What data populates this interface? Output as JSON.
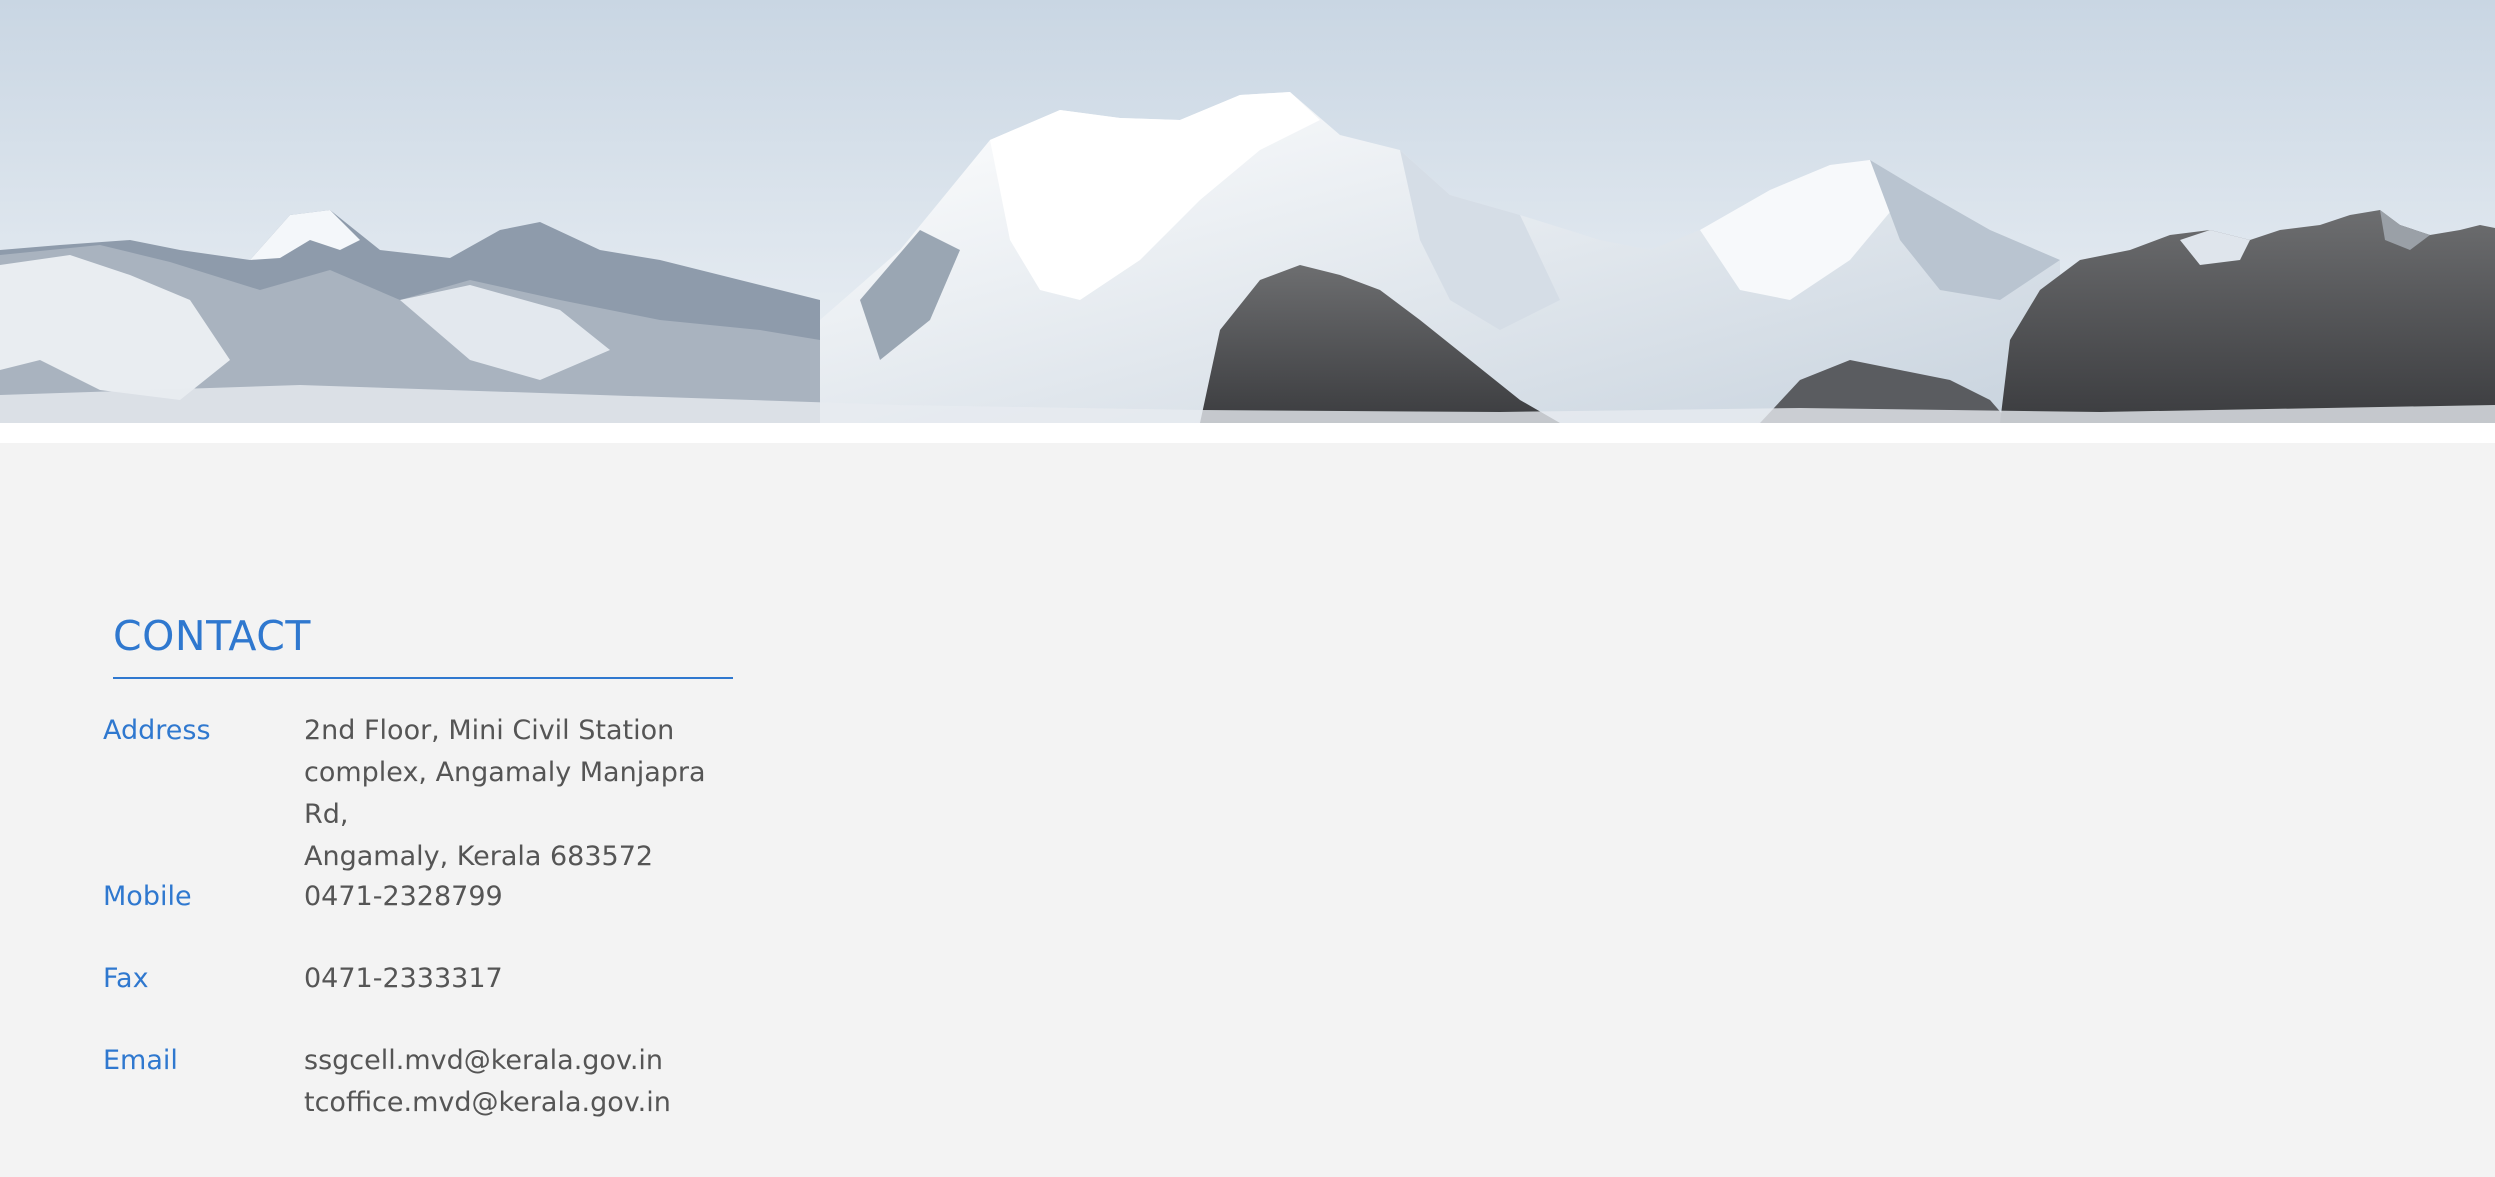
{
  "contact": {
    "title": "CONTACT",
    "address_label": "Address",
    "address_lines": [
      "2nd Floor, Mini Civil Station",
      "complex, Angamaly Manjapra Rd,",
      "Angamaly, Kerala 683572"
    ],
    "mobile_label": "Mobile",
    "mobile_value": "0471-2328799",
    "fax_label": "Fax",
    "fax_value": "0471-2333317",
    "email_label": "Email",
    "email_values": [
      "ssgcell.mvd@kerala.gov.in",
      "tcoffice.mvd@kerala.gov.in"
    ]
  },
  "colors": {
    "accent": "#2f78cf",
    "text": "#555555",
    "background": "#f3f3f3"
  }
}
